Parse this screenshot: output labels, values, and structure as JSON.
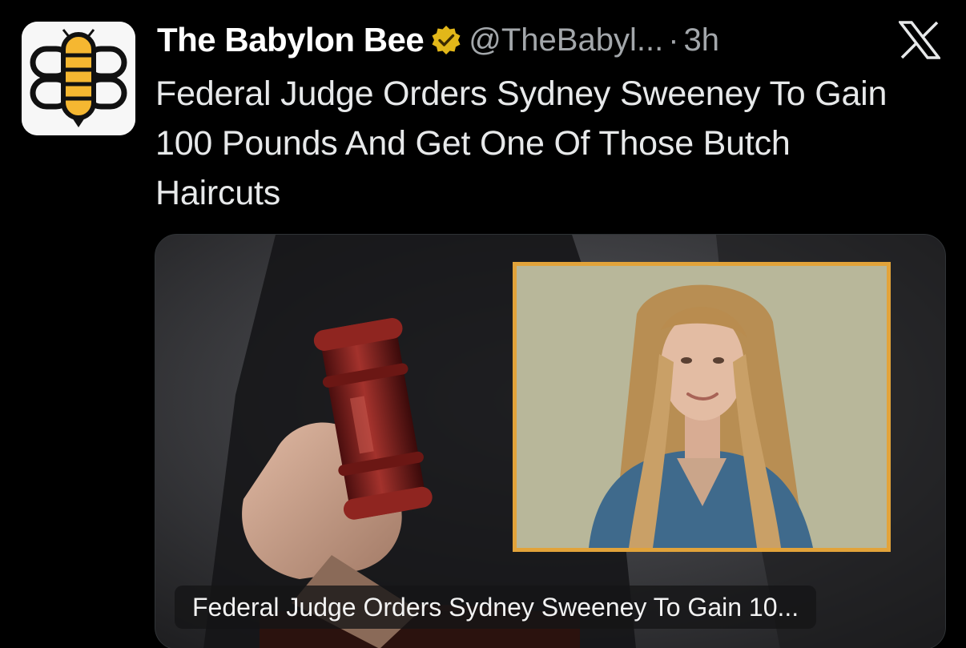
{
  "post": {
    "author": {
      "display_name": "The Babylon Bee",
      "handle": "@TheBabyl...",
      "verified": true,
      "verified_color": "#e2b719",
      "avatar_icon": "babylon-bee-logo"
    },
    "separator": "·",
    "time": "3h",
    "platform_icon": "x-logo-icon",
    "text": "Federal Judge Orders Sydney Sweeney To Gain 100 Pounds And Get One Of Those Butch Haircuts",
    "media": {
      "caption": "Federal Judge Orders Sydney Sweeney To Gain 10...",
      "frame_color": "#e2a33a"
    }
  },
  "colors": {
    "background": "#000000",
    "primary_text": "#e7e9ea",
    "secondary_text": "#a3a7ab",
    "bee_yellow": "#f5b731"
  }
}
